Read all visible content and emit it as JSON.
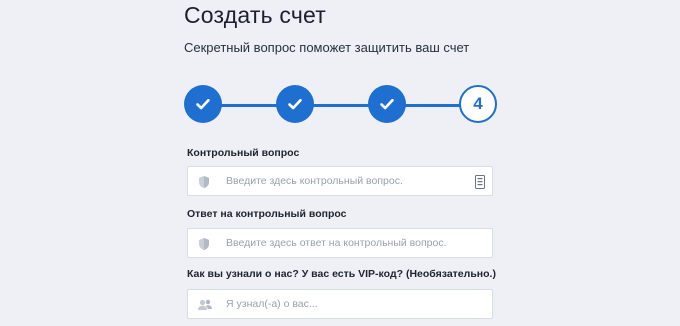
{
  "header": {
    "title": "Создать счет",
    "subtitle": "Секретный вопрос поможет защитить ваш счет"
  },
  "stepper": {
    "steps": [
      {
        "state": "done",
        "icon": "check-icon"
      },
      {
        "state": "done",
        "icon": "check-icon"
      },
      {
        "state": "done",
        "icon": "check-icon"
      },
      {
        "state": "current",
        "label": "4"
      }
    ],
    "accent_color": "#1e6fd0"
  },
  "form": {
    "security_question": {
      "label": "Контрольный вопрос",
      "placeholder": "Введите здесь контрольный вопрос.",
      "value": "",
      "icon": "shield-icon",
      "trailing_icon": "list-icon"
    },
    "security_answer": {
      "label": "Ответ на контрольный вопрос",
      "placeholder": "Введите здесь ответ на контрольный вопрос.",
      "value": "",
      "icon": "shield-icon"
    },
    "referral": {
      "label": "Как вы узнали о нас? У вас есть VIP-код? (Необязательно.)",
      "placeholder": "Я узнал(-а) о вас...",
      "value": "",
      "icon": "users-icon"
    }
  }
}
